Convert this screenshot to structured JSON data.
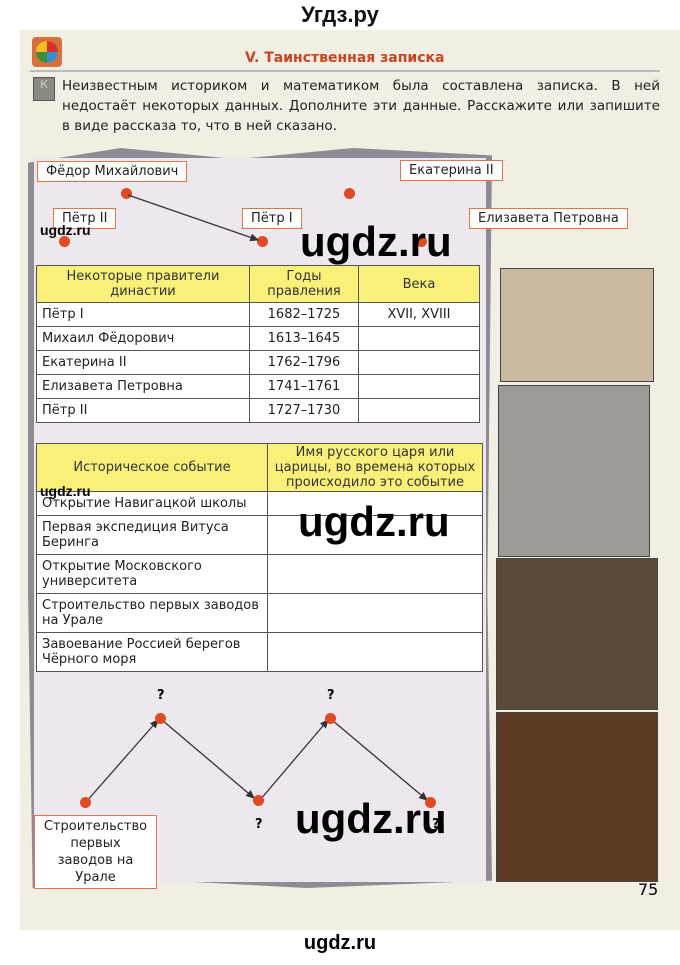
{
  "site_title": "Угдз.ру",
  "section_title": "V.  Таинственная  записка",
  "badge": "К",
  "intro": "Неизвестным историком и математиком была составлена записка. В ней недостаёт некоторых данных. Дополните эти данные. Расскажите или запишите в виде рассказа то, что в ней сказано.",
  "names": [
    "Фёдор  Михайлович",
    "Екатерина  II",
    "Пётр  II",
    "Пётр  I",
    "Елизавета  Петровна"
  ],
  "table1": {
    "headers": [
      "Некоторые правители династии",
      "Годы правления",
      "Века"
    ],
    "rows": [
      [
        "Пётр  I",
        "1682–1725",
        "XVII,  XVIII"
      ],
      [
        "Михаил  Фёдорович",
        "1613–1645",
        ""
      ],
      [
        "Екатерина  II",
        "1762–1796",
        ""
      ],
      [
        "Елизавета  Петровна",
        "1741–1761",
        ""
      ],
      [
        "Пётр  II",
        "1727–1730",
        ""
      ]
    ]
  },
  "table2": {
    "headers": [
      "Историческое событие",
      "Имя русского царя или царицы, во времена которых происходило это событие"
    ],
    "rows": [
      "Открытие  Навигацкой  школы",
      "Первая  экспедиция  Витуса Беринга",
      "Открытие  Московского  университета",
      "Строительство  первых  заводов  на  Урале",
      "Завоевание  Россией  берегов Чёрного  моря"
    ]
  },
  "diagram": {
    "box": "Строительство первых заводов на Урале",
    "question": "?"
  },
  "page_number": "75",
  "watermark": "ugdz.ru",
  "footer": "ugdz.ru"
}
